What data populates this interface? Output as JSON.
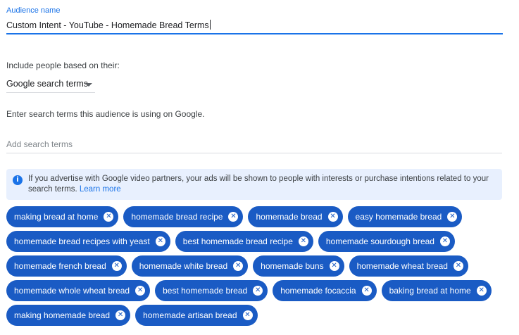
{
  "audience": {
    "label": "Audience name",
    "value": "Custom Intent - YouTube - Homemade Bread Terms"
  },
  "include": {
    "label": "Include people based on their:",
    "dropdown_value": "Google search terms"
  },
  "search_terms": {
    "help": "Enter search terms this audience is using on Google.",
    "placeholder": "Add search terms"
  },
  "info": {
    "icon": "info-icon",
    "text": "If you advertise with Google video partners, your ads will be shown to people with interests or purchase intentions related to your search terms.",
    "link": "Learn more"
  },
  "chip_rows": [
    [
      "making bread at home",
      "homemade bread recipe",
      "homemade bread",
      "easy homemade bread"
    ],
    [
      "homemade bread recipes with yeast",
      "best homemade bread recipe",
      "homemade sourdough bread"
    ],
    [
      "homemade french bread",
      "homemade white bread",
      "homemade buns",
      "homemade wheat bread"
    ],
    [
      "homemade whole wheat bread",
      "best homemade bread",
      "homemade focaccia",
      "baking bread at home"
    ],
    [
      "making homemade bread",
      "homemade artisan bread"
    ]
  ],
  "colors": {
    "accent": "#1a73e8",
    "chip_bg": "#1a5bc4",
    "info_bg": "#e8f0fe"
  }
}
